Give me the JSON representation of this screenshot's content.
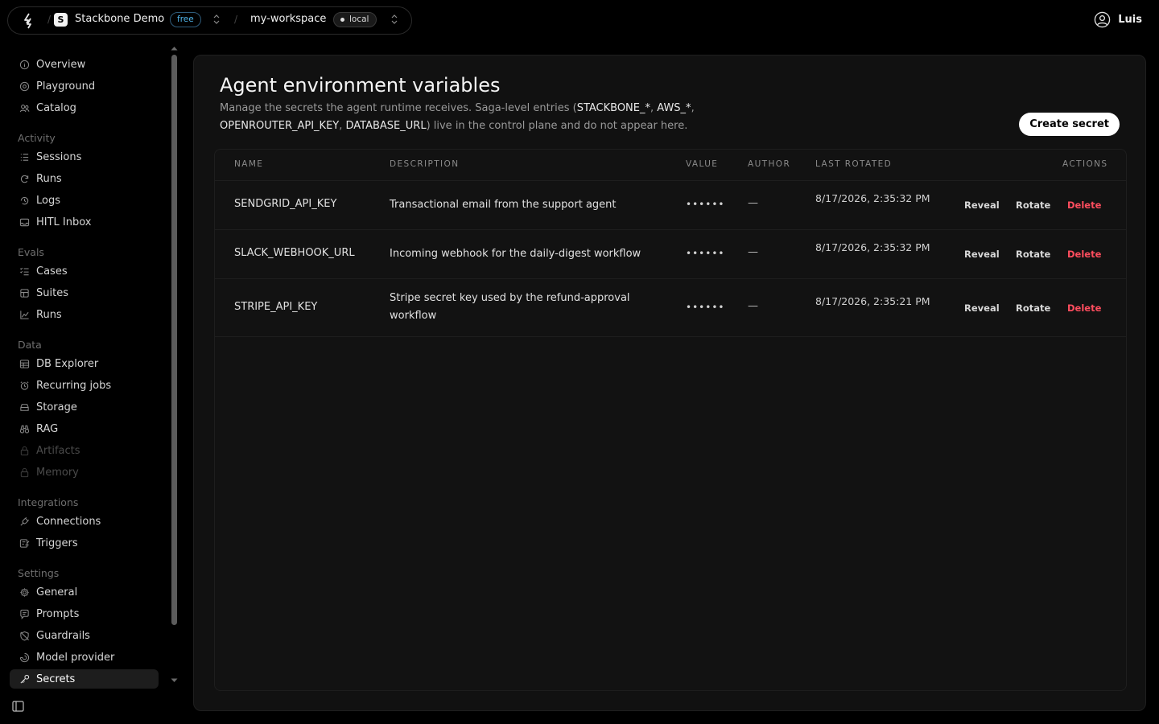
{
  "topbar": {
    "org_initial": "S",
    "org_name": "Stackbone Demo",
    "plan_badge": "free",
    "workspace_name": "my-workspace",
    "env_badge": "local",
    "user_name": "Luis"
  },
  "sidebar": {
    "top_items": [
      {
        "label": "Overview",
        "icon": "info-circle-icon"
      },
      {
        "label": "Playground",
        "icon": "target-icon"
      },
      {
        "label": "Catalog",
        "icon": "users-icon"
      }
    ],
    "groups": [
      {
        "label": "Activity",
        "items": [
          {
            "label": "Sessions",
            "icon": "list-icon"
          },
          {
            "label": "Runs",
            "icon": "refresh-icon"
          },
          {
            "label": "Logs",
            "icon": "history-icon"
          },
          {
            "label": "HITL Inbox",
            "icon": "inbox-icon"
          }
        ]
      },
      {
        "label": "Evals",
        "items": [
          {
            "label": "Cases",
            "icon": "checklist-icon"
          },
          {
            "label": "Suites",
            "icon": "box-icon"
          },
          {
            "label": "Runs",
            "icon": "chart-line-icon"
          }
        ]
      },
      {
        "label": "Data",
        "items": [
          {
            "label": "DB Explorer",
            "icon": "table-icon"
          },
          {
            "label": "Recurring jobs",
            "icon": "alarm-icon"
          },
          {
            "label": "Storage",
            "icon": "storage-icon"
          },
          {
            "label": "RAG",
            "icon": "binoculars-icon"
          },
          {
            "label": "Artifacts",
            "icon": "lock-icon",
            "disabled": true
          },
          {
            "label": "Memory",
            "icon": "lock-icon",
            "disabled": true
          }
        ]
      },
      {
        "label": "Integrations",
        "items": [
          {
            "label": "Connections",
            "icon": "plug-icon"
          },
          {
            "label": "Triggers",
            "icon": "trigger-icon"
          }
        ]
      },
      {
        "label": "Settings",
        "items": [
          {
            "label": "General",
            "icon": "gear-icon"
          },
          {
            "label": "Prompts",
            "icon": "chat-icon"
          },
          {
            "label": "Guardrails",
            "icon": "shield-off-icon"
          },
          {
            "label": "Model provider",
            "icon": "model-icon"
          },
          {
            "label": "Secrets",
            "icon": "key-icon",
            "active": true
          }
        ]
      }
    ]
  },
  "main": {
    "title": "Agent environment variables",
    "description": {
      "p1": "Manage the secrets the agent runtime receives. Saga-level entries (",
      "c1": "STACKBONE_*",
      "s1": ", ",
      "c2": "AWS_*",
      "s2": ", ",
      "c3": "OPENROUTER_API_KEY",
      "s3": ", ",
      "c4": "DATABASE_URL",
      "p2": ") live in the control plane and do not appear here."
    },
    "create_button": "Create secret",
    "table": {
      "headers": {
        "name": "Name",
        "description": "Description",
        "value": "Value",
        "author": "Author",
        "last_rotated": "Last rotated",
        "actions": "Actions"
      },
      "rows": [
        {
          "name": "SENDGRID_API_KEY",
          "description": "Transactional email from the support agent",
          "value": "••••••",
          "author": "—",
          "last_rotated": "8/17/2026, 2:35:32 PM"
        },
        {
          "name": "SLACK_WEBHOOK_URL",
          "description": "Incoming webhook for the daily-digest workflow",
          "value": "••••••",
          "author": "—",
          "last_rotated": "8/17/2026, 2:35:32 PM"
        },
        {
          "name": "STRIPE_API_KEY",
          "description": "Stripe secret key used by the refund-approval workflow",
          "value": "••••••",
          "author": "—",
          "last_rotated": "8/17/2026, 2:35:21 PM"
        }
      ],
      "actions": {
        "reveal": "Reveal",
        "rotate": "Rotate",
        "delete": "Delete"
      }
    }
  },
  "colors": {
    "background": "#000000",
    "panel": "#111111",
    "accent_badge": "#4fb3e8",
    "danger": "#ff4d5e",
    "primary_button": "#ffffff"
  }
}
